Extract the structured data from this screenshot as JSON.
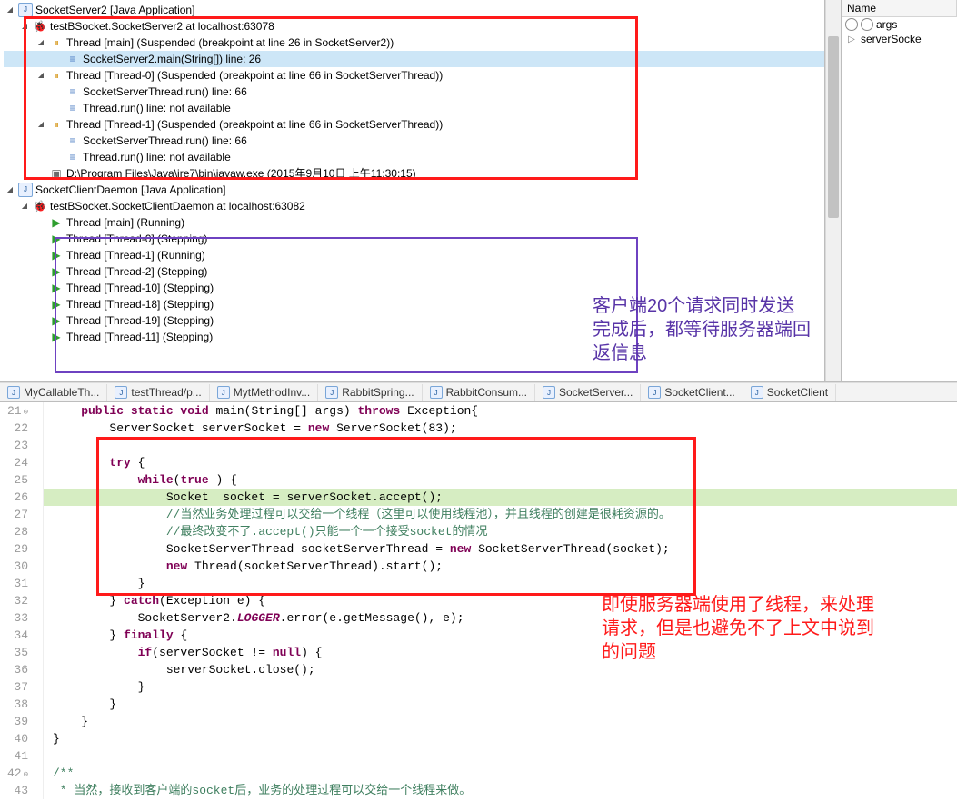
{
  "debug": {
    "app1": {
      "title": "SocketServer2 [Java Application]",
      "launch": "testBSocket.SocketServer2 at localhost:63078",
      "threads": [
        {
          "name": "Thread [main] (Suspended (breakpoint at line 26 in SocketServer2))",
          "open": true,
          "frames": [
            {
              "label": "SocketServer2.main(String[]) line: 26",
              "selected": true
            }
          ]
        },
        {
          "name": "Thread [Thread-0] (Suspended (breakpoint at line 66 in SocketServerThread))",
          "open": true,
          "frames": [
            {
              "label": "SocketServerThread.run() line: 66"
            },
            {
              "label": "Thread.run() line: not available"
            }
          ]
        },
        {
          "name": "Thread [Thread-1] (Suspended (breakpoint at line 66 in SocketServerThread))",
          "open": true,
          "frames": [
            {
              "label": "SocketServerThread.run() line: 66"
            },
            {
              "label": "Thread.run() line: not available"
            }
          ]
        }
      ],
      "host": "D:\\Program Files\\Java\\jre7\\bin\\javaw.exe (2015年9月10日 上午11:30:15)"
    },
    "app2": {
      "title": "SocketClientDaemon [Java Application]",
      "launch": "testBSocket.SocketClientDaemon at localhost:63082",
      "threads": [
        {
          "name": "Thread [main] (Running)",
          "state": "run"
        },
        {
          "name": "Thread [Thread-0] (Stepping)",
          "state": "run"
        },
        {
          "name": "Thread [Thread-1] (Running)",
          "state": "run"
        },
        {
          "name": "Thread [Thread-2] (Stepping)",
          "state": "run"
        },
        {
          "name": "Thread [Thread-10] (Stepping)",
          "state": "run"
        },
        {
          "name": "Thread [Thread-18] (Stepping)",
          "state": "run"
        },
        {
          "name": "Thread [Thread-19] (Stepping)",
          "state": "run"
        },
        {
          "name": "Thread [Thread-11] (Stepping)",
          "state": "run"
        }
      ]
    }
  },
  "annot_purple": "客户端20个请求同时发送完成后，都等待服务器端回返信息",
  "annot_red": "即使服务器端使用了线程，来处理请求，但是也避免不了上文中说到的问题",
  "vars": {
    "header": "Name",
    "rows": [
      {
        "icon": "circle",
        "label": "args"
      },
      {
        "icon": "arrow",
        "label": "serverSocke"
      }
    ]
  },
  "tabs": [
    "MyCallableTh...",
    "testThread/p...",
    "MytMethodInv...",
    "RabbitSpring...",
    "RabbitConsum...",
    "SocketServer...",
    "SocketClient...",
    "SocketClient"
  ],
  "code": {
    "start": 21,
    "lines": [
      {
        "n": 21,
        "seg": [
          [
            "kw",
            "    public static void"
          ],
          [
            "",
            " main(String[] args) "
          ],
          [
            "kw",
            "throws"
          ],
          [
            "",
            " Exception{"
          ]
        ]
      },
      {
        "n": 22,
        "seg": [
          [
            "",
            "        ServerSocket serverSocket = "
          ],
          [
            "kw",
            "new"
          ],
          [
            "",
            " ServerSocket(83);"
          ]
        ]
      },
      {
        "n": 23,
        "seg": [
          [
            "",
            ""
          ]
        ]
      },
      {
        "n": 24,
        "seg": [
          [
            "kw",
            "        try"
          ],
          [
            "",
            " {"
          ]
        ]
      },
      {
        "n": 25,
        "seg": [
          [
            "kw",
            "            while"
          ],
          [
            "",
            "("
          ],
          [
            "kw",
            "true"
          ],
          [
            "",
            " ) {"
          ]
        ]
      },
      {
        "n": 26,
        "hi": true,
        "seg": [
          [
            "",
            "                Socket  socket = serverSocket.accept();"
          ]
        ]
      },
      {
        "n": 27,
        "seg": [
          [
            "cm",
            "                //当然业务处理过程可以交给一个线程（这里可以使用线程池），并且线程的创建是很耗资源的。"
          ]
        ]
      },
      {
        "n": 28,
        "seg": [
          [
            "cm",
            "                //最终改变不了.accept()只能一个一个接受socket的情况"
          ]
        ]
      },
      {
        "n": 29,
        "seg": [
          [
            "",
            "                SocketServerThread socketServerThread = "
          ],
          [
            "kw",
            "new"
          ],
          [
            "",
            " SocketServerThread(socket);"
          ]
        ]
      },
      {
        "n": 30,
        "seg": [
          [
            "kw",
            "                new"
          ],
          [
            "",
            " Thread(socketServerThread).start();"
          ]
        ]
      },
      {
        "n": 31,
        "seg": [
          [
            "",
            "            }"
          ]
        ]
      },
      {
        "n": 32,
        "seg": [
          [
            "",
            "        } "
          ],
          [
            "kw",
            "catch"
          ],
          [
            "",
            "(Exception e) {"
          ]
        ]
      },
      {
        "n": 33,
        "seg": [
          [
            "",
            "            SocketServer2."
          ],
          [
            "st",
            "LOGGER"
          ],
          [
            "",
            ".error(e.getMessage(), e);"
          ]
        ]
      },
      {
        "n": 34,
        "seg": [
          [
            "",
            "        } "
          ],
          [
            "kw",
            "finally"
          ],
          [
            "",
            " {"
          ]
        ]
      },
      {
        "n": 35,
        "seg": [
          [
            "kw",
            "            if"
          ],
          [
            "",
            "(serverSocket != "
          ],
          [
            "kw",
            "null"
          ],
          [
            "",
            ") {"
          ]
        ]
      },
      {
        "n": 36,
        "seg": [
          [
            "",
            "                serverSocket.close();"
          ]
        ]
      },
      {
        "n": 37,
        "seg": [
          [
            "",
            "            }"
          ]
        ]
      },
      {
        "n": 38,
        "seg": [
          [
            "",
            "        }"
          ]
        ]
      },
      {
        "n": 39,
        "seg": [
          [
            "",
            "    }"
          ]
        ]
      },
      {
        "n": 40,
        "seg": [
          [
            "",
            "}"
          ]
        ]
      },
      {
        "n": 41,
        "seg": [
          [
            "",
            ""
          ]
        ]
      },
      {
        "n": 42,
        "seg": [
          [
            "cm",
            "/**"
          ]
        ]
      },
      {
        "n": 43,
        "seg": [
          [
            "cm",
            " * 当然，接收到客户端的socket后，业务的处理过程可以交给一个线程来做。"
          ]
        ]
      }
    ]
  }
}
